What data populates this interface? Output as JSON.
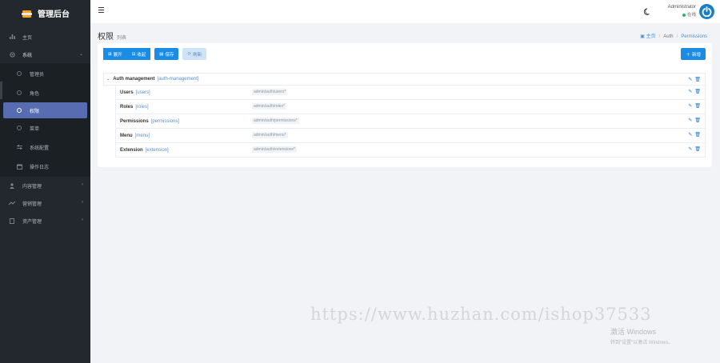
{
  "brand": {
    "title": "管理后台"
  },
  "sidebar": {
    "items": [
      {
        "label": "主页"
      },
      {
        "label": "系统"
      },
      {
        "label": "内容管理"
      },
      {
        "label": "营销管理"
      },
      {
        "label": "资产管理"
      }
    ],
    "system_children": [
      {
        "label": "管理员"
      },
      {
        "label": "角色"
      },
      {
        "label": "权限"
      },
      {
        "label": "菜单"
      },
      {
        "label": "系统配置"
      },
      {
        "label": "操作日志"
      }
    ]
  },
  "header": {
    "user_name": "Administrator",
    "user_status": "在线"
  },
  "page": {
    "title": "权限",
    "subtitle": "列表",
    "breadcrumb": {
      "home": "主页",
      "section": "Auth",
      "current": "Permissions"
    }
  },
  "toolbar": {
    "expand": "展开",
    "collapse": "收起",
    "save": "保存",
    "refresh": "刷新",
    "new": "新增"
  },
  "tree": {
    "root": {
      "name": "Auth management",
      "slug": "[auth-management]"
    },
    "children": [
      {
        "name": "Users",
        "slug": "[users]",
        "path": "admin/auth/users*"
      },
      {
        "name": "Roles",
        "slug": "[roles]",
        "path": "admin/auth/roles*"
      },
      {
        "name": "Permissions",
        "slug": "[permissions]",
        "path": "admin/auth/permissions*"
      },
      {
        "name": "Menu",
        "slug": "[menu]",
        "path": "admin/auth/menu*"
      },
      {
        "name": "Extension",
        "slug": "[extension]",
        "path": "admin/auth/extensions*"
      }
    ]
  },
  "overlay": {
    "watermark": "https://www.huzhan.com/ishop37533",
    "activate_title": "激活 Windows",
    "activate_hint": "转到\"设置\"以激活 Windows。"
  },
  "colors": {
    "accent": "#1a8ce6",
    "sidebar_bg": "#22282e",
    "active_item": "#586cb1",
    "online": "#21b978"
  }
}
